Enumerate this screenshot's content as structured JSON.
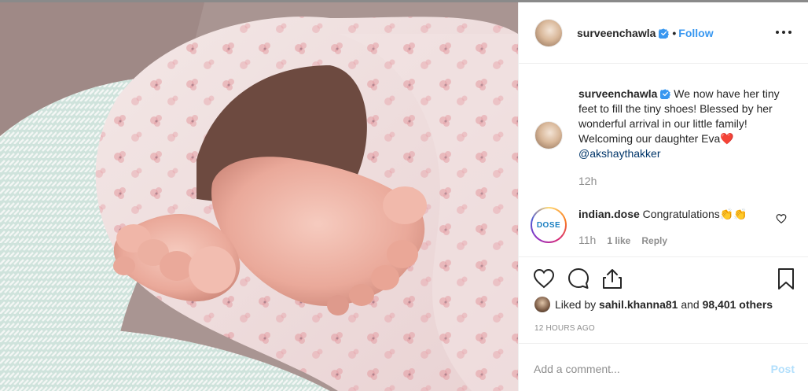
{
  "post": {
    "photo_alt": "",
    "author": "surveenchawla",
    "follow_label": "Follow",
    "caption_user": "surveenchawla",
    "caption_text": " We now have her tiny feet to fill the tiny shoes! Blessed by her wonderful arrival in our little family! Welcoming our daughter Eva❤️ ",
    "caption_mention": "@akshaythakker",
    "caption_time": "12h"
  },
  "comment": {
    "avatar_text": "DOSE",
    "user": "indian.dose",
    "text": " Congratulations👏👏",
    "time": "11h",
    "likes": "1 like",
    "reply_label": "Reply"
  },
  "likes": {
    "prefix": "Liked by ",
    "user": "sahil.khanna81",
    "suffix": " and ",
    "count": "98,401 others"
  },
  "timestamp": "12 HOURS AGO",
  "composer": {
    "placeholder": "Add a comment...",
    "post_label": "Post"
  },
  "icons": {
    "verified": "verified-badge-icon",
    "more": "more-options-icon",
    "like": "heart-icon",
    "comment": "comment-icon",
    "share": "share-icon",
    "save": "bookmark-icon"
  },
  "colors": {
    "link": "#3897f0",
    "mention": "#003569",
    "muted": "#8e8e8e",
    "post_disabled": "#b2dffc"
  }
}
